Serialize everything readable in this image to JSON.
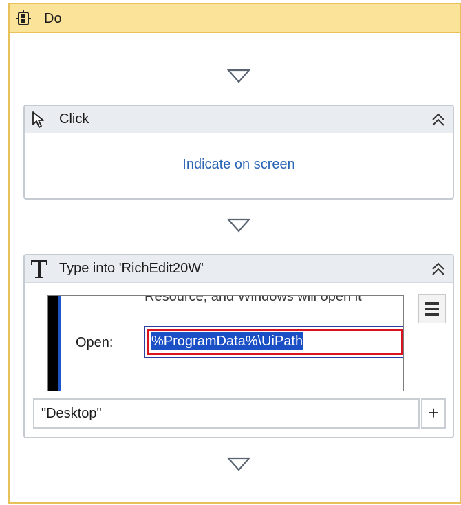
{
  "do_block": {
    "title": "Do"
  },
  "click_activity": {
    "title": "Click",
    "indicate_label": "Indicate on screen"
  },
  "type_activity": {
    "title": "Type into 'RichEdit20W'",
    "preview": {
      "cut_text": "Resource, and Windows will open it",
      "open_label": "Open:",
      "open_value": "%ProgramData%\\UiPath"
    },
    "selector_value": "\"Desktop\"",
    "plus_label": "+"
  },
  "icons": {
    "do": "sequence-gear-icon",
    "click": "cursor-pointer-icon",
    "type": "type-text-T-icon",
    "collapse": "double-chevron-up-icon",
    "menu": "hamburger-menu-icon",
    "drop": "drop-arrow-down-icon"
  },
  "colors": {
    "do_header_bg": "#fbe39a",
    "do_border": "#e8c15a",
    "link": "#2a64b5",
    "selection": "#1b4fc6",
    "highlight_red": "#d9141e"
  }
}
